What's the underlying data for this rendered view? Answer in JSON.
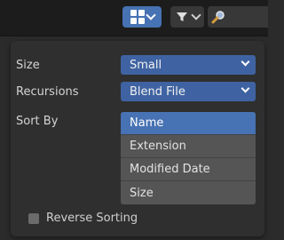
{
  "settings": {
    "size": {
      "label": "Size",
      "value": "Small"
    },
    "recursions": {
      "label": "Recursions",
      "value": "Blend File"
    },
    "sort_by": {
      "label": "Sort By",
      "options": [
        "Name",
        "Extension",
        "Modified Date",
        "Size"
      ],
      "selected": "Name"
    },
    "reverse_sorting": {
      "label": "Reverse Sorting",
      "checked": false
    }
  },
  "toolbar": {
    "icons": [
      "display-mode-grid-icon",
      "filter-icon",
      "search-icon"
    ]
  }
}
